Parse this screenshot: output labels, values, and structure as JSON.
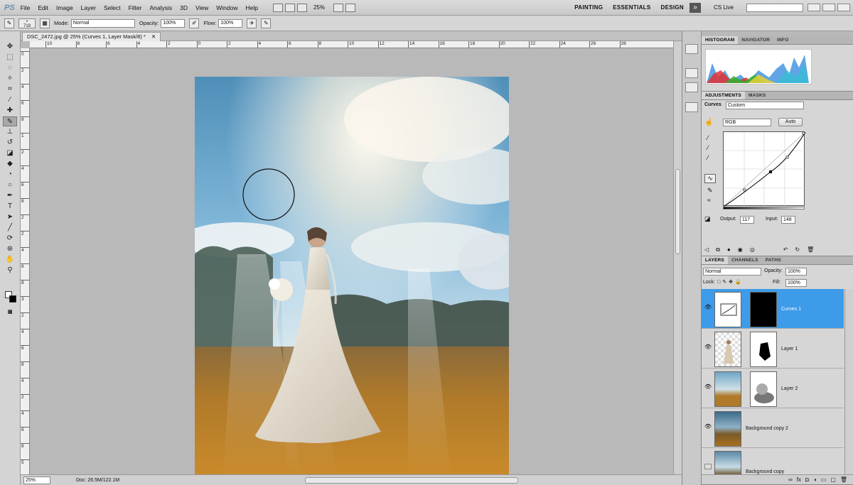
{
  "app": {
    "logo": "PS"
  },
  "menu": [
    "File",
    "Edit",
    "Image",
    "Layer",
    "Select",
    "Filter",
    "Analysis",
    "3D",
    "View",
    "Window",
    "Help"
  ],
  "zoom_menu": "25%",
  "workspaces": [
    "PAINTING",
    "ESSENTIALS",
    "DESIGN"
  ],
  "cs_live": "CS Live",
  "options": {
    "brush_size": "719",
    "mode_label": "Mode:",
    "mode_value": "Normal",
    "opacity_label": "Opacity:",
    "opacity_value": "100%",
    "flow_label": "Flow:",
    "flow_value": "100%"
  },
  "document": {
    "tab_title": "DSC_2472.jpg @ 25% (Curves 1, Layer Mask/8) *",
    "ruler_top": [
      "10",
      "8",
      "6",
      "4",
      "2",
      "0",
      "2",
      "4",
      "6",
      "8",
      "10",
      "12",
      "14",
      "16",
      "18",
      "20",
      "22",
      "24",
      "26",
      "28"
    ],
    "ruler_left": [
      "0",
      "2",
      "4",
      "6",
      "8",
      "1",
      "2",
      "4",
      "6",
      "8",
      "2",
      "2",
      "4",
      "6",
      "8",
      "3",
      "2",
      "4",
      "6",
      "8",
      "4",
      "2",
      "4",
      "6",
      "8",
      "5"
    ]
  },
  "status": {
    "zoom": "25%",
    "doc": "Doc: 26.5M/122.1M"
  },
  "histogram_panel": {
    "tabs": [
      "HISTOGRAM",
      "NAVIGATOR",
      "INFO"
    ]
  },
  "adjustments_panel": {
    "tabs": [
      "ADJUSTMENTS",
      "MASKS"
    ],
    "type": "Curves",
    "preset": "Custom",
    "channel": "RGB",
    "auto_label": "Auto",
    "output_label": "Output:",
    "output_value": "117",
    "input_label": "Input:",
    "input_value": "148"
  },
  "layers_panel": {
    "tabs": [
      "LAYERS",
      "CHANNELS",
      "PATHS"
    ],
    "blend_mode": "Normal",
    "opacity_label": "Opacity:",
    "opacity_value": "100%",
    "lock_label": "Lock:",
    "fill_label": "Fill:",
    "fill_value": "100%",
    "layers": [
      {
        "name": "Curves 1",
        "selected": true
      },
      {
        "name": "Layer 1",
        "selected": false
      },
      {
        "name": "Layer 2",
        "selected": false
      },
      {
        "name": "Background copy 2",
        "selected": false
      },
      {
        "name": "Background copy",
        "selected": false
      }
    ]
  },
  "colors": {
    "selection": "#3d9be9",
    "panel": "#d6d6d6"
  }
}
